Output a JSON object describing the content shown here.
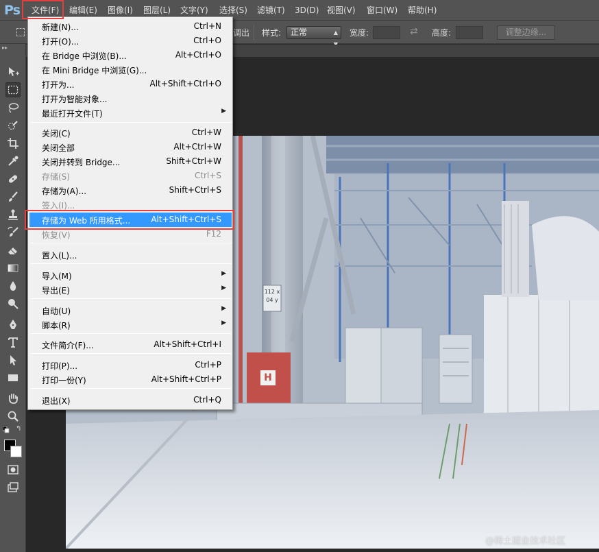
{
  "app": {
    "logo": "Ps"
  },
  "menubar": {
    "items": [
      "文件(F)",
      "编辑(E)",
      "图像(I)",
      "图层(L)",
      "文字(Y)",
      "选择(S)",
      "滤镜(T)",
      "3D(D)",
      "视图(V)",
      "窗口(W)",
      "帮助(H)"
    ],
    "highlight_color": "#e2403f"
  },
  "options": {
    "partial_text": "调出",
    "style_label": "样式:",
    "style_value": "正常",
    "width_label": "宽度:",
    "height_label": "高度:",
    "refine_button": "调整边缘..."
  },
  "file_menu": {
    "groups": [
      [
        {
          "label": "新建(N)...",
          "shortcut": "Ctrl+N"
        },
        {
          "label": "打开(O)...",
          "shortcut": "Ctrl+O"
        },
        {
          "label": "在 Bridge 中浏览(B)...",
          "shortcut": "Alt+Ctrl+O"
        },
        {
          "label": "在 Mini Bridge 中浏览(G)...",
          "shortcut": ""
        },
        {
          "label": "打开为...",
          "shortcut": "Alt+Shift+Ctrl+O"
        },
        {
          "label": "打开为智能对象...",
          "shortcut": ""
        },
        {
          "label": "最近打开文件(T)",
          "shortcut": "",
          "submenu": true
        }
      ],
      [
        {
          "label": "关闭(C)",
          "shortcut": "Ctrl+W"
        },
        {
          "label": "关闭全部",
          "shortcut": "Alt+Ctrl+W"
        },
        {
          "label": "关闭并转到 Bridge...",
          "shortcut": "Shift+Ctrl+W"
        },
        {
          "label": "存储(S)",
          "shortcut": "Ctrl+S",
          "disabled": true
        },
        {
          "label": "存储为(A)...",
          "shortcut": "Shift+Ctrl+S"
        },
        {
          "label": "签入(I)...",
          "shortcut": "",
          "disabled": true
        },
        {
          "label": "存储为 Web 所用格式...",
          "shortcut": "Alt+Shift+Ctrl+S",
          "highlighted": true
        },
        {
          "label": "恢复(V)",
          "shortcut": "F12",
          "disabled": true
        }
      ],
      [
        {
          "label": "置入(L)...",
          "shortcut": ""
        }
      ],
      [
        {
          "label": "导入(M)",
          "shortcut": "",
          "submenu": true
        },
        {
          "label": "导出(E)",
          "shortcut": "",
          "submenu": true
        }
      ],
      [
        {
          "label": "自动(U)",
          "shortcut": "",
          "submenu": true
        },
        {
          "label": "脚本(R)",
          "shortcut": "",
          "submenu": true
        }
      ],
      [
        {
          "label": "文件简介(F)...",
          "shortcut": "Alt+Shift+Ctrl+I"
        }
      ],
      [
        {
          "label": "打印(P)...",
          "shortcut": "Ctrl+P"
        },
        {
          "label": "打印一份(Y)",
          "shortcut": "Alt+Shift+Ctrl+P"
        }
      ],
      [
        {
          "label": "退出(X)",
          "shortcut": "Ctrl+Q"
        }
      ]
    ],
    "highlight_color": "#3399ff"
  },
  "toolbar": {
    "tools": [
      "move-tool",
      "rectangular-marquee-tool",
      "lasso-tool",
      "quick-selection-tool",
      "crop-tool",
      "eyedropper-tool",
      "spot-healing-brush-tool",
      "brush-tool",
      "clone-stamp-tool",
      "history-brush-tool",
      "eraser-tool",
      "gradient-tool",
      "blur-tool",
      "dodge-tool",
      "pen-tool",
      "type-tool",
      "path-selection-tool",
      "rectangle-tool",
      "hand-tool",
      "zoom-tool"
    ],
    "active_tool": "rectangular-marquee-tool",
    "foreground_color": "#000000",
    "background_color": "#ffffff"
  },
  "photo": {
    "sign_text_1": "112 x",
    "sign_text_2": "04 y",
    "hydrant_letter": "H"
  },
  "watermark": "@稀土掘金技术社区"
}
